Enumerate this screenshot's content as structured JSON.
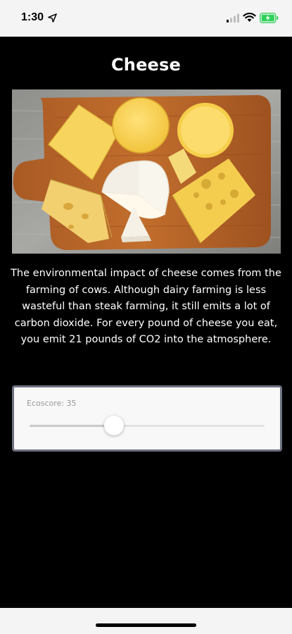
{
  "status_bar": {
    "time": "1:30",
    "icons": [
      "location-arrow-icon",
      "signal-icon",
      "wifi-icon",
      "battery-charging-icon"
    ],
    "battery_color": "#2fd158"
  },
  "page": {
    "title": "Cheese",
    "image_alt": "Cheese board with assorted cheeses",
    "description": "The environmental impact of cheese comes from the farming of cows. Although dairy farming is less wasteful than steak farming, it still emits a lot of carbon dioxide. For every pound of cheese you eat, you emit 21 pounds of CO2 into the atmosphere."
  },
  "ecoscore": {
    "label": "Ecoscore: 35",
    "value": 35,
    "slider_fraction": 0.36
  }
}
